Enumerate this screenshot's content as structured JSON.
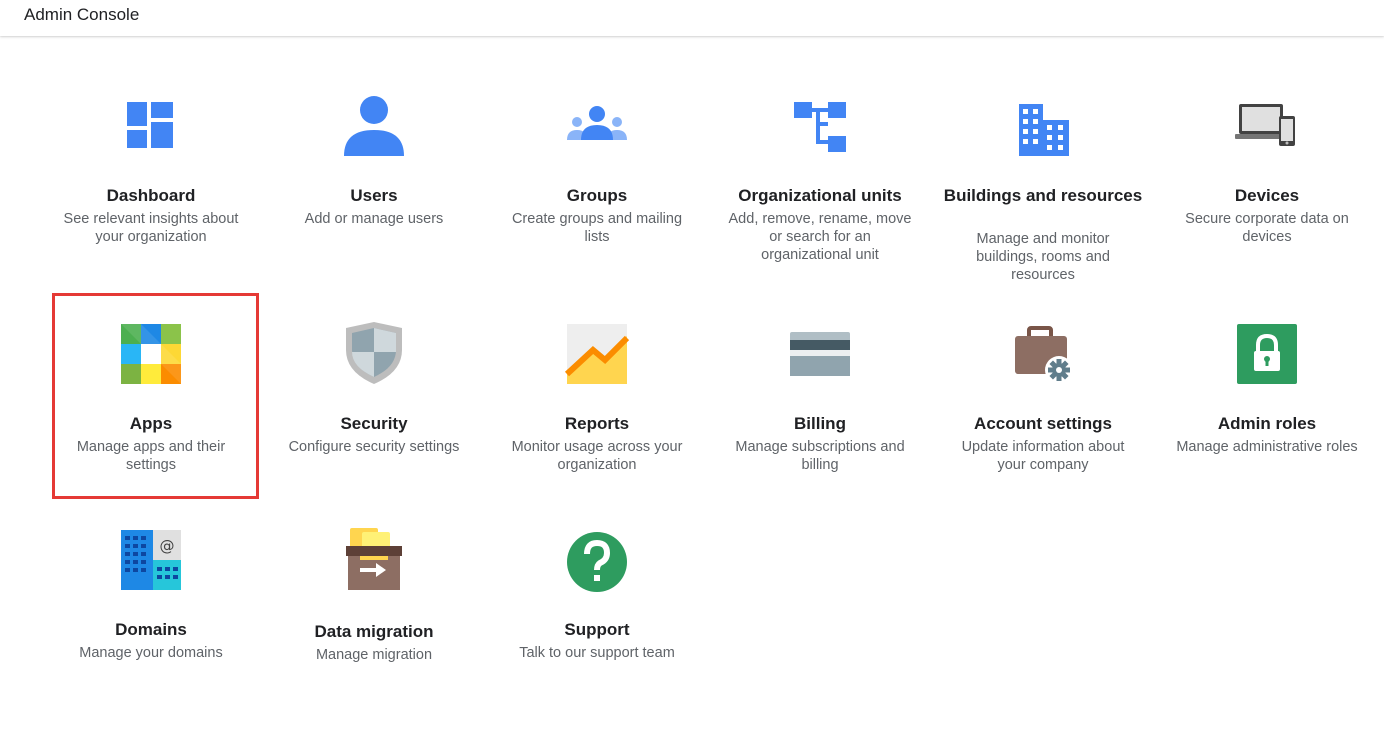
{
  "app": {
    "title": "Admin Console"
  },
  "tiles": [
    {
      "name": "Dashboard",
      "desc": "See relevant insights about your organization",
      "icon": "dashboard-icon"
    },
    {
      "name": "Users",
      "desc": "Add or manage users",
      "icon": "user-icon"
    },
    {
      "name": "Groups",
      "desc": "Create groups and mailing lists",
      "icon": "groups-icon"
    },
    {
      "name": "Organizational units",
      "desc": "Add, remove, rename, move or search for an organizational unit",
      "icon": "org-units-icon"
    },
    {
      "name": "Buildings and resources",
      "desc": "Manage and monitor buildings, rooms and resources",
      "icon": "building-icon"
    },
    {
      "name": "Devices",
      "desc": "Secure corporate data on devices",
      "icon": "devices-icon"
    },
    {
      "name": "Apps",
      "desc": "Manage apps and their settings",
      "icon": "apps-icon"
    },
    {
      "name": "Security",
      "desc": "Configure security settings",
      "icon": "shield-icon"
    },
    {
      "name": "Reports",
      "desc": "Monitor usage across your organization",
      "icon": "reports-chart-icon"
    },
    {
      "name": "Billing",
      "desc": "Manage subscriptions and billing",
      "icon": "credit-card-icon"
    },
    {
      "name": "Account settings",
      "desc": "Update information about your company",
      "icon": "briefcase-gear-icon"
    },
    {
      "name": "Admin roles",
      "desc": "Manage administrative roles",
      "icon": "lock-icon"
    },
    {
      "name": "Domains",
      "desc": "Manage your domains",
      "icon": "domains-icon"
    },
    {
      "name": "Data migration",
      "desc": "Manage migration",
      "icon": "data-migration-icon"
    },
    {
      "name": "Support",
      "desc": "Talk to our support team",
      "icon": "help-icon"
    }
  ],
  "highlighted_tile": "Apps",
  "colors": {
    "highlight_border": "#e53935",
    "primary_blue": "#4285f4",
    "title_text": "#202124",
    "desc_text": "#5f6368"
  }
}
